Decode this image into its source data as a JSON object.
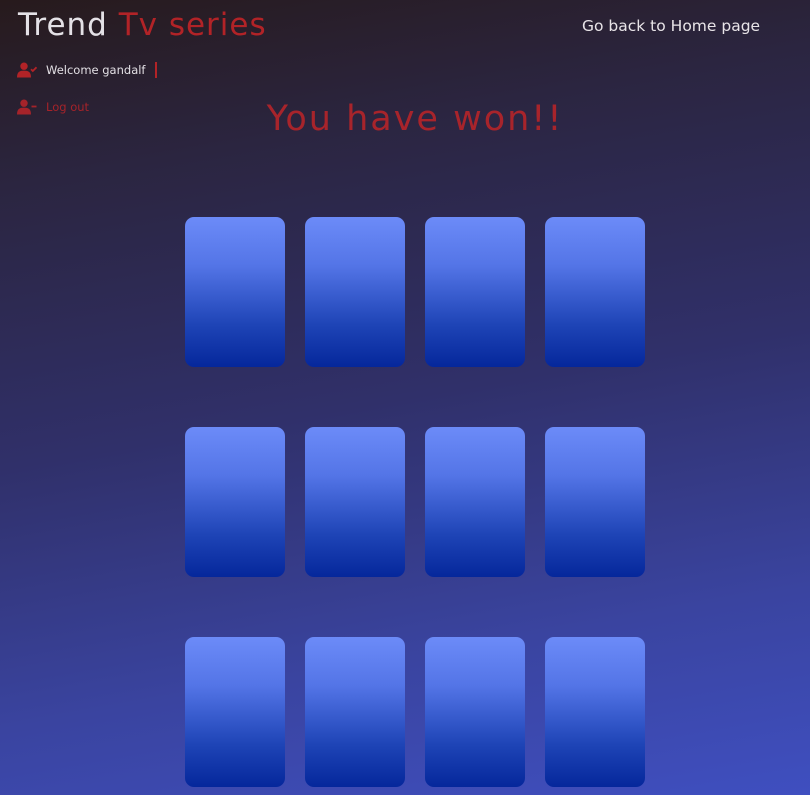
{
  "brand": {
    "word1": "Trend",
    "word2": "Tv series"
  },
  "nav": {
    "home_link": "Go back to Home page"
  },
  "user": {
    "welcome": "Welcome gandalf",
    "logout": "Log out"
  },
  "status": {
    "message": "You have won!!"
  },
  "colors": {
    "accent": "#b22327",
    "card_top": "#6c8bf8",
    "card_bottom": "#05279b"
  },
  "icons": {
    "user_check": "user-check-icon",
    "user_minus": "user-minus-icon"
  },
  "cards": [
    {
      "state": "face-down"
    },
    {
      "state": "face-down"
    },
    {
      "state": "face-down"
    },
    {
      "state": "face-down"
    },
    {
      "state": "face-down"
    },
    {
      "state": "face-down"
    },
    {
      "state": "face-down"
    },
    {
      "state": "face-down"
    },
    {
      "state": "face-down"
    },
    {
      "state": "face-down"
    },
    {
      "state": "face-down"
    },
    {
      "state": "face-down"
    }
  ]
}
